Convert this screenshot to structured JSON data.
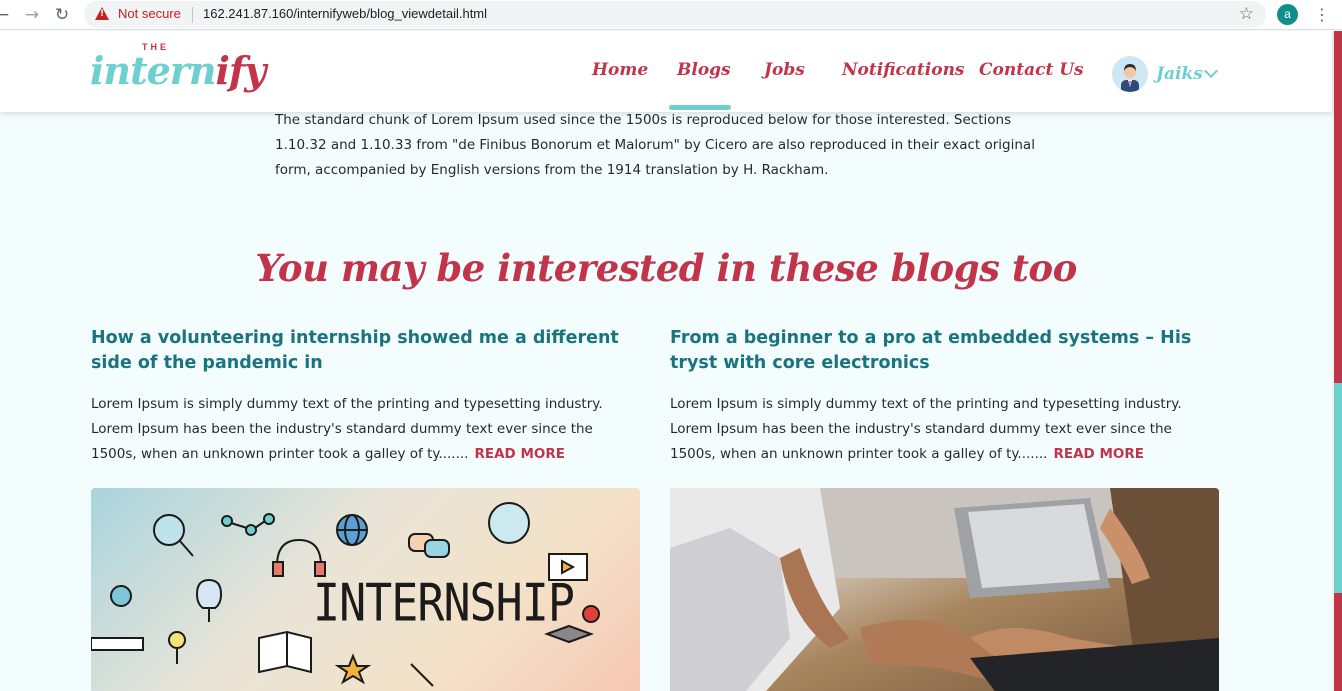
{
  "browser": {
    "security_label": "Not secure",
    "url": "162.241.87.160/internifyweb/blog_viewdetail.html",
    "profile_initial": "a",
    "icons": [
      "back-icon",
      "forward-icon",
      "reload-icon",
      "warning-icon",
      "star-icon",
      "menu-icon"
    ]
  },
  "site": {
    "logo_the": "THE",
    "logo_intern": "intern",
    "logo_ify": "ify",
    "colors": {
      "accent_red": "#c2344a",
      "accent_teal": "#6ecfcf",
      "title_teal": "#1a7480"
    }
  },
  "nav": {
    "items": [
      {
        "label": "Home"
      },
      {
        "label": "Blogs",
        "active": true
      },
      {
        "label": "Jobs"
      },
      {
        "label": "Notifications"
      },
      {
        "label": "Contact Us"
      }
    ],
    "user_name": "Jaiks"
  },
  "content": {
    "intro": "The standard chunk of Lorem Ipsum used since the 1500s is reproduced below for those interested. Sections 1.10.32 and 1.10.33 from \"de Finibus Bonorum et Malorum\" by Cicero are also reproduced in their exact original form, accompanied by English versions from the 1914 translation by H. Rackham.",
    "section_title": "You may be interested in these blogs too",
    "cards": [
      {
        "title": "How a volunteering internship showed me a different side of the pandemic in",
        "excerpt": "Lorem Ipsum is simply dummy text of the printing and typesetting industry. Lorem Ipsum has been the industry's standard dummy text ever since the 1500s, when an unknown printer took a galley of ty.......",
        "read_more": "READ MORE",
        "image_text": "INTERNSHIP"
      },
      {
        "title": "From a beginner to a pro at embedded systems – His tryst with core electronics",
        "excerpt": "Lorem Ipsum is simply dummy text of the printing and typesetting industry. Lorem Ipsum has been the industry's standard dummy text ever since the 1500s, when an unknown printer took a galley of ty.......",
        "read_more": "READ MORE"
      }
    ]
  }
}
